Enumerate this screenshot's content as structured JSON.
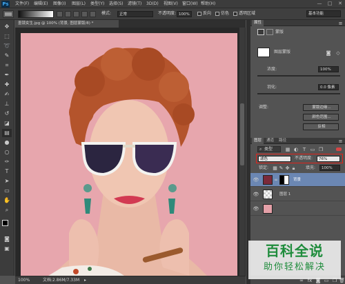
{
  "app": {
    "logo": "Ps"
  },
  "menubar": {
    "items": [
      "文件(F)",
      "编辑(E)",
      "图像(I)",
      "图层(L)",
      "类型(Y)",
      "选择(S)",
      "滤镜(T)",
      "3D(D)",
      "视图(V)",
      "窗口(W)",
      "帮助(H)"
    ],
    "window_controls": [
      "—",
      "□",
      "✕"
    ]
  },
  "options_bar": {
    "mode_label": "模式:",
    "mode_value": "正常",
    "opacity_label": "不透明度:",
    "opacity_value": "100%",
    "reverse_label": "反向",
    "dither_label": "仿色",
    "transparency_label": "透明区域",
    "workspace_value": "基本功能"
  },
  "document": {
    "tab_title": "墨镜女生.jpg @ 100% (背景, 图层蒙版/8) *",
    "zoom": "100%",
    "doc_info": "文档:2.86M/7.33M"
  },
  "properties_panel": {
    "tabs": [
      "属性"
    ],
    "mask_label": "蒙版",
    "layer_mask_label": "图层蒙版",
    "density_label": "浓度:",
    "density_value": "100%",
    "feather_label": "羽化:",
    "feather_value": "0.0 像素",
    "adjust_label": "调整:",
    "btn_mask_edge": "蒙版边缘...",
    "btn_color_range": "颜色范围...",
    "btn_invert": "反相"
  },
  "layers_panel": {
    "tabs": [
      "图层",
      "通道",
      "路径"
    ],
    "kind_label": "类型",
    "blend_mode": "滤色",
    "opacity_label": "不透明度:",
    "opacity_value": "76%",
    "lock_label": "锁定:",
    "fill_label": "填充:",
    "fill_value": "100%",
    "layers": [
      {
        "name": "背景",
        "selected": true,
        "has_mask": true
      },
      {
        "name": "图层 1",
        "selected": false,
        "has_mask": false
      },
      {
        "name": "",
        "selected": false,
        "has_mask": false
      }
    ]
  },
  "watermark": {
    "title": "百科全说",
    "subtitle": "助你轻松解决"
  },
  "colors": {
    "photo_background": "#e7a6ad",
    "hair": "#b4542c",
    "highlight_box": "#e2231a",
    "watermark_text": "#1f8c3c"
  }
}
